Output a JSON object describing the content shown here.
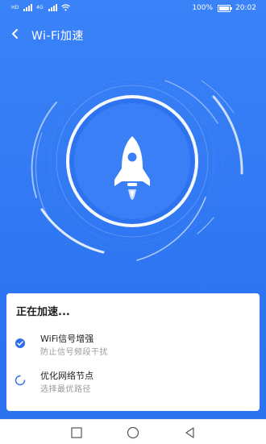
{
  "status_bar": {
    "network_tag_1": "HD",
    "network_tag_2": "4G",
    "battery": "100%",
    "time": "20:02",
    "icons": [
      "signal-icon",
      "signal-icon",
      "wifi-icon",
      "battery-icon"
    ]
  },
  "header": {
    "title": "Wi-Fi加速",
    "back_icon": "chevron-left-icon"
  },
  "animation": {
    "center_icon": "rocket-icon"
  },
  "card": {
    "title": "正在加速...",
    "items": [
      {
        "title": "WiFi信号增强",
        "desc": "防止信号频段干扰",
        "status": "done",
        "icon": "check-icon"
      },
      {
        "title": "优化网络节点",
        "desc": "选择最优路径",
        "status": "loading",
        "icon": "spinner-icon"
      }
    ]
  },
  "nav_bar": {
    "icons": [
      "recent-apps-icon",
      "home-icon",
      "back-triangle-icon"
    ]
  },
  "colors": {
    "background": "#2f76f2",
    "accent": "#2f6fe8",
    "card": "#ffffff"
  }
}
